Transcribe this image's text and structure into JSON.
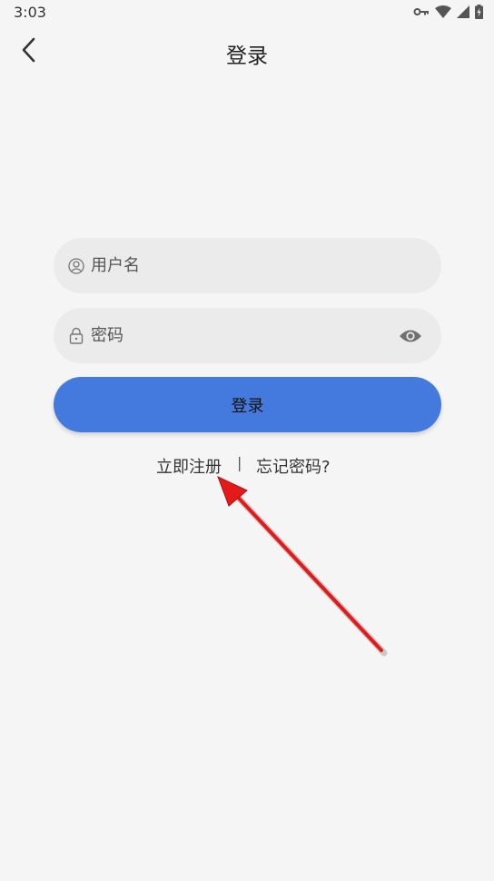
{
  "status_bar": {
    "time": "3:03",
    "icons": [
      "key-icon",
      "wifi-icon",
      "signal-icon",
      "battery-charging-icon"
    ]
  },
  "header": {
    "back_icon": "chevron-left-icon",
    "title": "登录"
  },
  "form": {
    "username": {
      "icon": "user-icon",
      "placeholder": "用户名",
      "value": ""
    },
    "password": {
      "icon": "lock-icon",
      "placeholder": "密码",
      "value": "",
      "toggle_icon": "eye-icon"
    },
    "login_label": "登录"
  },
  "links": {
    "register": "立即注册",
    "divider": "|",
    "forgot": "忘记密码?"
  },
  "colors": {
    "background": "#f5f5f5",
    "field_bg": "#ebebeb",
    "primary": "#4479dd",
    "annotation_arrow": "#e3191a"
  }
}
